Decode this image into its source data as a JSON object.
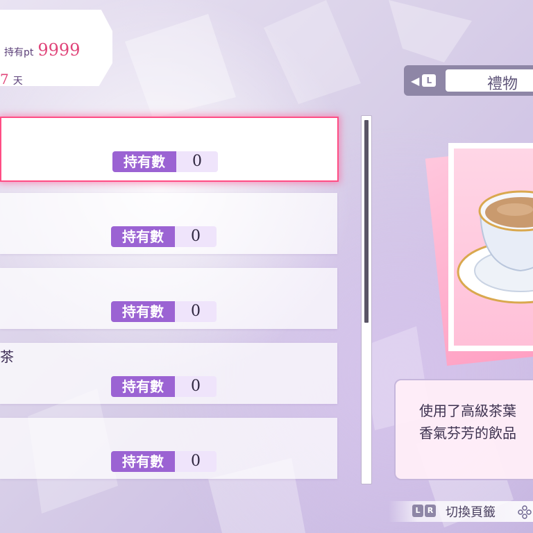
{
  "status": {
    "points_label": "持有pt",
    "points_value": "9999",
    "days_value": "7",
    "days_unit": "天"
  },
  "tab": {
    "prev_key": "L",
    "category_label": "禮物"
  },
  "items": [
    {
      "name": "",
      "qty_label": "持有數",
      "qty": "0",
      "selected": true
    },
    {
      "name": "",
      "qty_label": "持有數",
      "qty": "0",
      "selected": false
    },
    {
      "name": "",
      "qty_label": "持有數",
      "qty": "0",
      "selected": false
    },
    {
      "name": "茶",
      "qty_label": "持有數",
      "qty": "0",
      "selected": false
    },
    {
      "name": "",
      "qty_label": "持有數",
      "qty": "0",
      "selected": false
    }
  ],
  "description": {
    "line1": "使用了高級茶葉",
    "line2": "香氣芬芳的飲品"
  },
  "hint": {
    "key_l": "L",
    "key_r": "R",
    "text": "切換頁籤"
  },
  "colors": {
    "accent_pink": "#ff4d84",
    "badge_purple": "#9b63d3",
    "points_pink": "#e0457a"
  }
}
